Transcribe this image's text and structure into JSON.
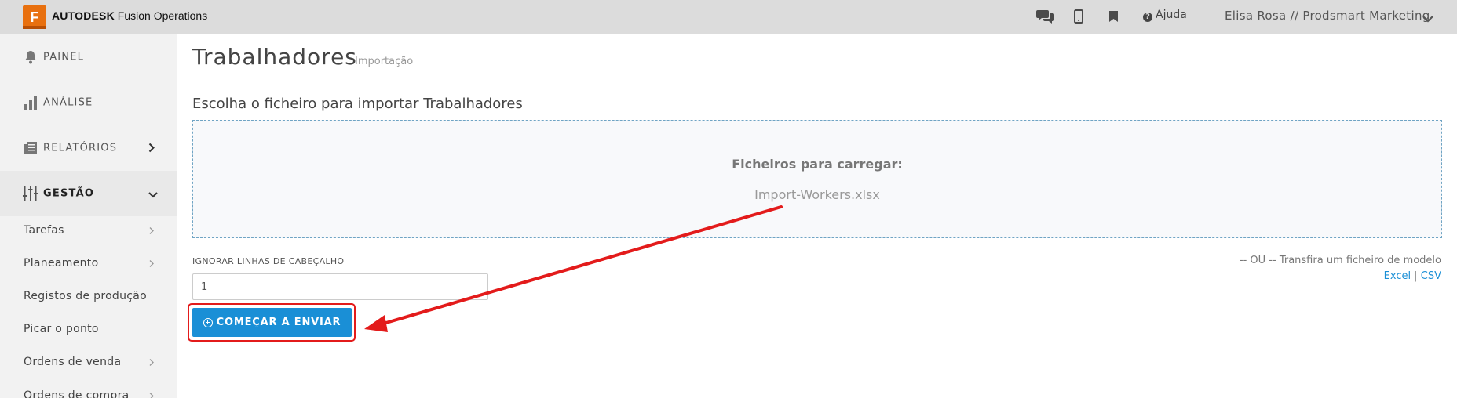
{
  "header": {
    "logo_letter": "F",
    "brand_bold": "AUTODESK",
    "brand_rest": "Fusion Operations",
    "help_label": "Ajuda",
    "user_label": "Elisa Rosa // Prodsmart Marketing",
    "icons": [
      "chat-icon",
      "mobile-icon",
      "bookmark-icon",
      "help-icon",
      "chevron-down-icon"
    ]
  },
  "sidebar": {
    "main_items": [
      {
        "label": "PAINEL",
        "icon": "bell-icon"
      },
      {
        "label": "ANÁLISE",
        "icon": "bar-chart-icon"
      },
      {
        "label": "RELATÓRIOS",
        "icon": "reports-icon"
      },
      {
        "label": "GESTÃO",
        "icon": "sliders-icon"
      }
    ],
    "sub_items": [
      {
        "label": "Tarefas"
      },
      {
        "label": "Planeamento"
      },
      {
        "label": "Registos de produção"
      },
      {
        "label": "Picar o ponto"
      },
      {
        "label": "Ordens de venda"
      },
      {
        "label": "Ordens de compra"
      }
    ]
  },
  "main": {
    "title": "Trabalhadores",
    "subtitle": "Importação",
    "choose_label": "Escolha o ficheiro para importar Trabalhadores",
    "dropzone_label": "Ficheiros para carregar:",
    "dropzone_file": "Import-Workers.xlsx",
    "ignore_label": "IGNORAR LINHAS DE CABEÇALHO",
    "ignore_value": "1",
    "start_button": "COMEÇAR A ENVIAR",
    "template_text": "-- OU -- Transfira um ficheiro de modelo",
    "template_excel": "Excel",
    "template_sep": " | ",
    "template_csv": "CSV"
  },
  "colors": {
    "accent": "#1a8fd6",
    "brand_orange": "#e8700f",
    "annotation_red": "#e31b1b"
  }
}
